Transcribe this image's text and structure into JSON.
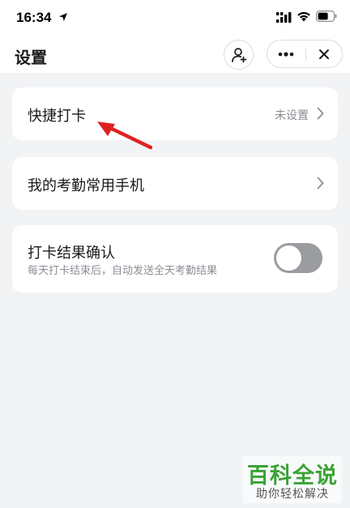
{
  "status_bar": {
    "time": "16:34",
    "icons": [
      "location-arrow-icon",
      "signal-icon",
      "wifi-icon",
      "battery-icon"
    ]
  },
  "nav": {
    "title": "设置",
    "buttons": [
      "add-friend-icon",
      "more-icon",
      "close-icon"
    ]
  },
  "rows": [
    {
      "label": "快捷打卡",
      "value": "未设置"
    },
    {
      "label": "我的考勤常用手机"
    },
    {
      "label": "打卡结果确认",
      "sublabel": "每天打卡结束后，自动发送全天考勤结果",
      "toggle_on": false
    }
  ],
  "annotation": {
    "color": "#e02020"
  },
  "watermark": {
    "title": "百科全说",
    "subtitle": "助你轻松解决",
    "color": "#3aa335"
  },
  "colors": {
    "background": "#f2f3f5",
    "card": "#ffffff",
    "toggle_off": "#9a9ca0",
    "secondary_text": "#8a8d93"
  }
}
